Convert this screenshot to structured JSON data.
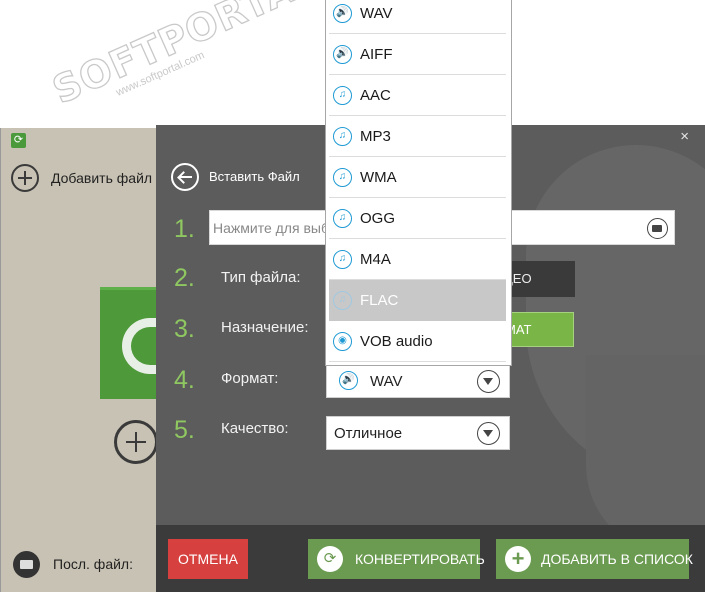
{
  "watermark": {
    "brand": "SOFTPORTAL",
    "trademark": "™",
    "site": "www.softportal.com"
  },
  "left_pane": {
    "add_file_label": "Добавить файл",
    "last_file_label": "Посл. файл:"
  },
  "dialog": {
    "close_glyph": "×",
    "back_label": "Вставить Файл",
    "steps": [
      {
        "num": "1.",
        "label": ""
      },
      {
        "num": "2.",
        "label": "Тип файла:"
      },
      {
        "num": "3.",
        "label": "Назначение:"
      },
      {
        "num": "4.",
        "label": "Формат:"
      },
      {
        "num": "5.",
        "label": "Качество:"
      }
    ],
    "file_input_text": "Нажмите для выб",
    "type_button_label": "ДЕО",
    "destination_button_label": "МАТ",
    "format_select_value": "WAV",
    "quality_select_value": "Отличное"
  },
  "footer": {
    "cancel_label": "ОТМЕНА",
    "convert_label": "КОНВЕРТИРОВАТЬ",
    "add_to_list_label": "ДОБАВИТЬ В СПИСОК"
  },
  "format_dropdown": {
    "items": [
      {
        "label": "WAV",
        "icon": "speaker-icon",
        "glyph": "🔊"
      },
      {
        "label": "AIFF",
        "icon": "speaker-icon",
        "glyph": "🔊"
      },
      {
        "label": "AAC",
        "icon": "music-note-icon",
        "glyph": "♫"
      },
      {
        "label": "MP3",
        "icon": "music-note-icon",
        "glyph": "♫"
      },
      {
        "label": "WMA",
        "icon": "music-note-icon",
        "glyph": "♫"
      },
      {
        "label": "OGG",
        "icon": "music-note-icon",
        "glyph": "♫"
      },
      {
        "label": "M4A",
        "icon": "music-note-icon",
        "glyph": "♫"
      },
      {
        "label": "FLAC",
        "icon": "music-note-icon",
        "glyph": "♫"
      },
      {
        "label": "VOB audio",
        "icon": "disc-icon",
        "glyph": "◉"
      }
    ],
    "selected_label": "FLAC"
  },
  "colors": {
    "accent_green": "#7ab547",
    "step_number_green": "#8fc861",
    "cancel_red": "#d6413f",
    "dialog_bg": "#5c5c5c",
    "dropdown_icon_blue": "#1f9ad4"
  }
}
